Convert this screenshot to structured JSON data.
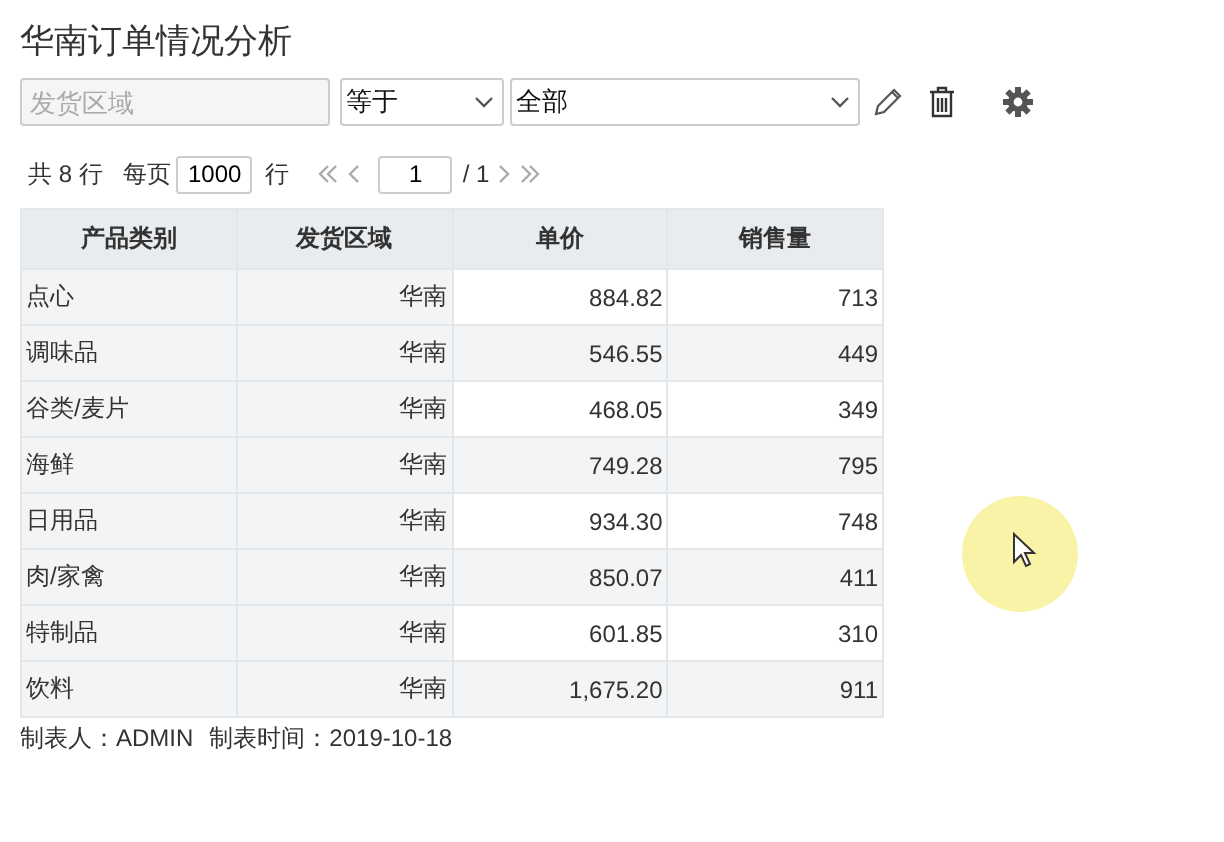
{
  "title": "华南订单情况分析",
  "filter": {
    "field": {
      "placeholder": "发货区域"
    },
    "operator": {
      "value": "等于"
    },
    "value": {
      "value": "全部"
    }
  },
  "pagination": {
    "total": "共 8 行",
    "per_page_label": "每页",
    "per_page": "1000",
    "rows_label": "行",
    "page": "1",
    "page_count": "/ 1"
  },
  "table": {
    "columns": [
      "产品类别",
      "发货区域",
      "单价",
      "销售量"
    ],
    "rows": [
      [
        "点心",
        "华南",
        "884.82",
        "713"
      ],
      [
        "调味品",
        "华南",
        "546.55",
        "449"
      ],
      [
        "谷类/麦片",
        "华南",
        "468.05",
        "349"
      ],
      [
        "海鲜",
        "华南",
        "749.28",
        "795"
      ],
      [
        "日用品",
        "华南",
        "934.30",
        "748"
      ],
      [
        "肉/家禽",
        "华南",
        "850.07",
        "411"
      ],
      [
        "特制品",
        "华南",
        "601.85",
        "310"
      ],
      [
        "饮料",
        "华南",
        "1,675.20",
        "911"
      ]
    ]
  },
  "footer": [
    "制表人：ADMIN",
    "制表时间：2019-10-18"
  ]
}
